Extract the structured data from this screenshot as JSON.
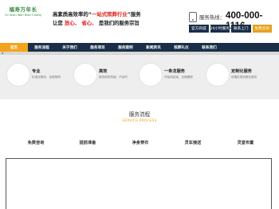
{
  "header": {
    "logo_cn": "福寿万年长",
    "logo_pinyin": "Fu Shou Wan Nian Chang",
    "slogan_prefix": "高素质高效率的“",
    "slogan_highlight": "一站式殡葬行业",
    "slogan_suffix": "”服务",
    "slogan2_a": "让您",
    "slogan2_b": "放心、",
    "slogan2_c": "省心、",
    "slogan2_d": "是我们的服务宗旨",
    "hotline_label": "服务热线：",
    "hotline_number": "400-000-1116",
    "quick_buttons": [
      {
        "label": "官方商城",
        "color": "#1a2e48"
      },
      {
        "label": "24小时服务",
        "color": "#1a2e48"
      },
      {
        "label": "联系上门",
        "color": "#1a2e48"
      },
      {
        "label": "免费咨询",
        "color": "#e6a11f"
      }
    ]
  },
  "nav": {
    "items": [
      "首页",
      "服务流程",
      "关于我们",
      "服务项目",
      "服务案例",
      "新闻资讯",
      "殡葬礼仪",
      "联系我们"
    ],
    "active_index": 0,
    "active_color": "#f3a41d",
    "bg_color": "#1a2e48"
  },
  "banner": {
    "features": [
      {
        "title": "专业",
        "desc": "标准化服务、全程规则"
      },
      {
        "title": "高效",
        "desc": "服务周到快速、不延时"
      },
      {
        "title": "一条龙服务",
        "desc": "开始到结束、全程跟踪"
      },
      {
        "title": "定制化服务",
        "desc": "依据实现特殊化服务"
      }
    ]
  },
  "process": {
    "title": "服务流程",
    "subtitle": "SERVICE PROCESS",
    "steps": [
      "免费咨询",
      "提前准备",
      "净身穿衣",
      "灵车接送",
      "灵堂布置"
    ]
  }
}
